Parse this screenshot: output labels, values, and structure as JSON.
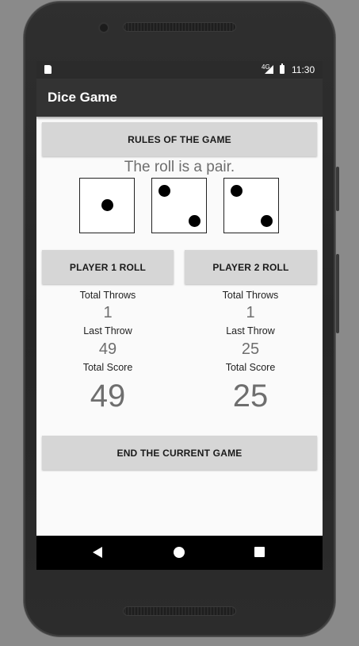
{
  "status_bar": {
    "time": "11:30",
    "network": "4G"
  },
  "app_bar": {
    "title": "Dice Game"
  },
  "rules_button": {
    "label": "RULES OF THE GAME"
  },
  "roll_result": {
    "text": "The roll is a pair."
  },
  "dice": [
    1,
    2,
    2
  ],
  "players": [
    {
      "roll_label": "PLAYER 1 ROLL",
      "total_throws_label": "Total Throws",
      "total_throws": "1",
      "last_throw_label": "Last Throw",
      "last_throw": "49",
      "total_score_label": "Total Score",
      "total_score": "49"
    },
    {
      "roll_label": "PLAYER 2 ROLL",
      "total_throws_label": "Total Throws",
      "total_throws": "1",
      "last_throw_label": "Last Throw",
      "last_throw": "25",
      "total_score_label": "Total Score",
      "total_score": "25"
    }
  ],
  "end_button": {
    "label": "END THE CURRENT GAME"
  },
  "nav_bar": {
    "back_icon": "back-triangle-icon",
    "home_icon": "home-circle-icon",
    "recents_icon": "recents-square-icon"
  },
  "colors": {
    "app_bar": "#333333",
    "button": "#d6d6d6",
    "value_text": "#6e6e6e"
  }
}
